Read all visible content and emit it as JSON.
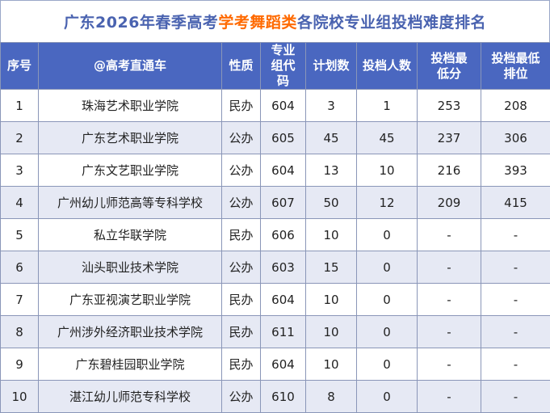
{
  "title": {
    "prefix": "广东2026年春季高考",
    "highlight": "学考舞蹈类",
    "suffix": "各院校专业组投档难度排名"
  },
  "headers": [
    "序号",
    "@高考直通车",
    "性质",
    "专业组代码",
    "计划数",
    "投档人数",
    "投档最低分",
    "投档最低排位"
  ],
  "rows": [
    [
      "1",
      "珠海艺术职业学院",
      "民办",
      "604",
      "3",
      "1",
      "253",
      "208"
    ],
    [
      "2",
      "广东艺术职业学院",
      "公办",
      "605",
      "45",
      "45",
      "237",
      "306"
    ],
    [
      "3",
      "广东文艺职业学院",
      "公办",
      "604",
      "13",
      "10",
      "216",
      "393"
    ],
    [
      "4",
      "广州幼儿师范高等专科学校",
      "公办",
      "607",
      "50",
      "12",
      "209",
      "415"
    ],
    [
      "5",
      "私立华联学院",
      "民办",
      "606",
      "10",
      "0",
      "-",
      "-"
    ],
    [
      "6",
      "汕头职业技术学院",
      "公办",
      "603",
      "15",
      "0",
      "-",
      "-"
    ],
    [
      "7",
      "广东亚视演艺职业学院",
      "民办",
      "604",
      "10",
      "0",
      "-",
      "-"
    ],
    [
      "8",
      "广州涉外经济职业技术学院",
      "民办",
      "611",
      "10",
      "0",
      "-",
      "-"
    ],
    [
      "9",
      "广东碧桂园职业学院",
      "民办",
      "604",
      "10",
      "0",
      "-",
      "-"
    ],
    [
      "10",
      "湛江幼儿师范专科学校",
      "公办",
      "610",
      "8",
      "0",
      "-",
      "-"
    ]
  ]
}
